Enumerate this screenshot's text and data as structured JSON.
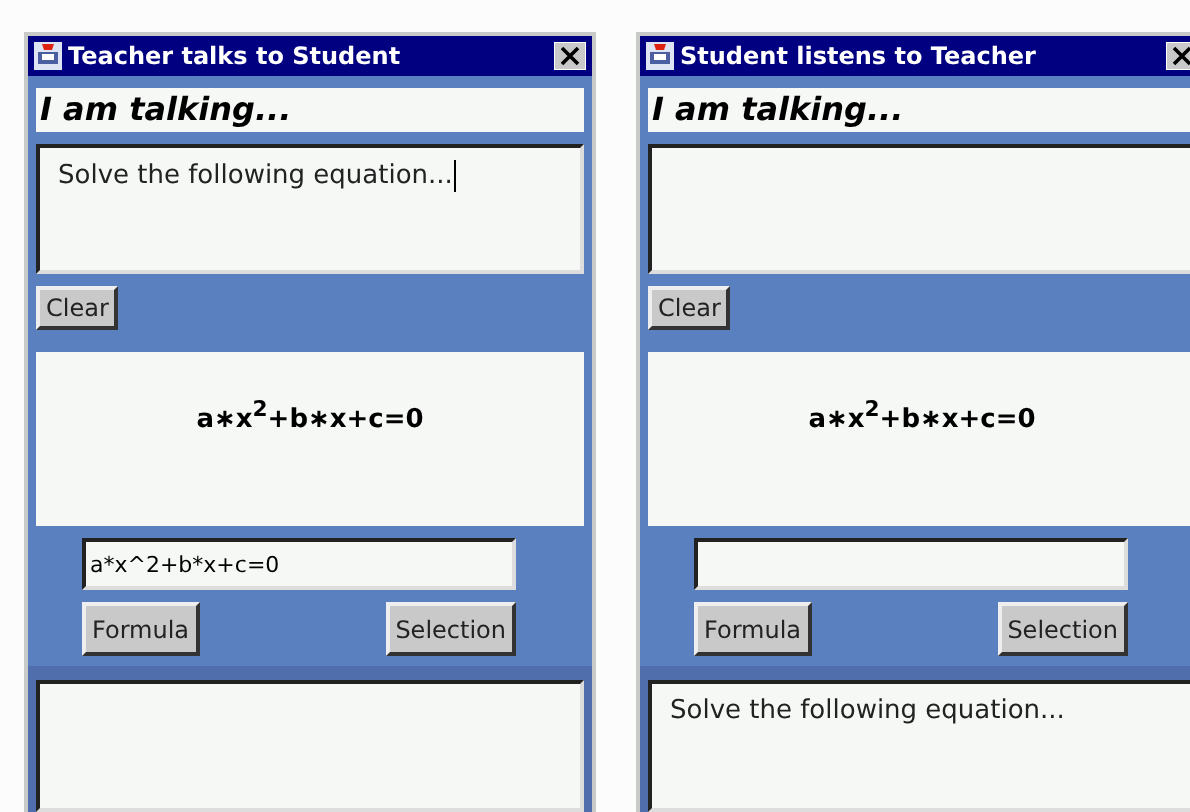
{
  "windows": [
    {
      "title": "Teacher talks to Student",
      "heading": "I am talking...",
      "message": {
        "text": "Solve the following equation...",
        "focused": true
      },
      "clear_button": "Clear",
      "formula_display": "a∗x$^{2}$+b∗x+c=0",
      "formula_input": "a*x^2+b*x+c=0",
      "buttons": [
        "Formula",
        "Selection"
      ]
    },
    {
      "title": "Student listens to Teacher",
      "heading": "I am talking...",
      "message": {
        "focused": false
      },
      "clear_button": "Clear",
      "formula_display": "a∗x$^{2}$+b∗x+c=0",
      "buttons": [
        "Formula",
        "Selection"
      ],
      "received": "Solve the following equation..."
    }
  ]
}
